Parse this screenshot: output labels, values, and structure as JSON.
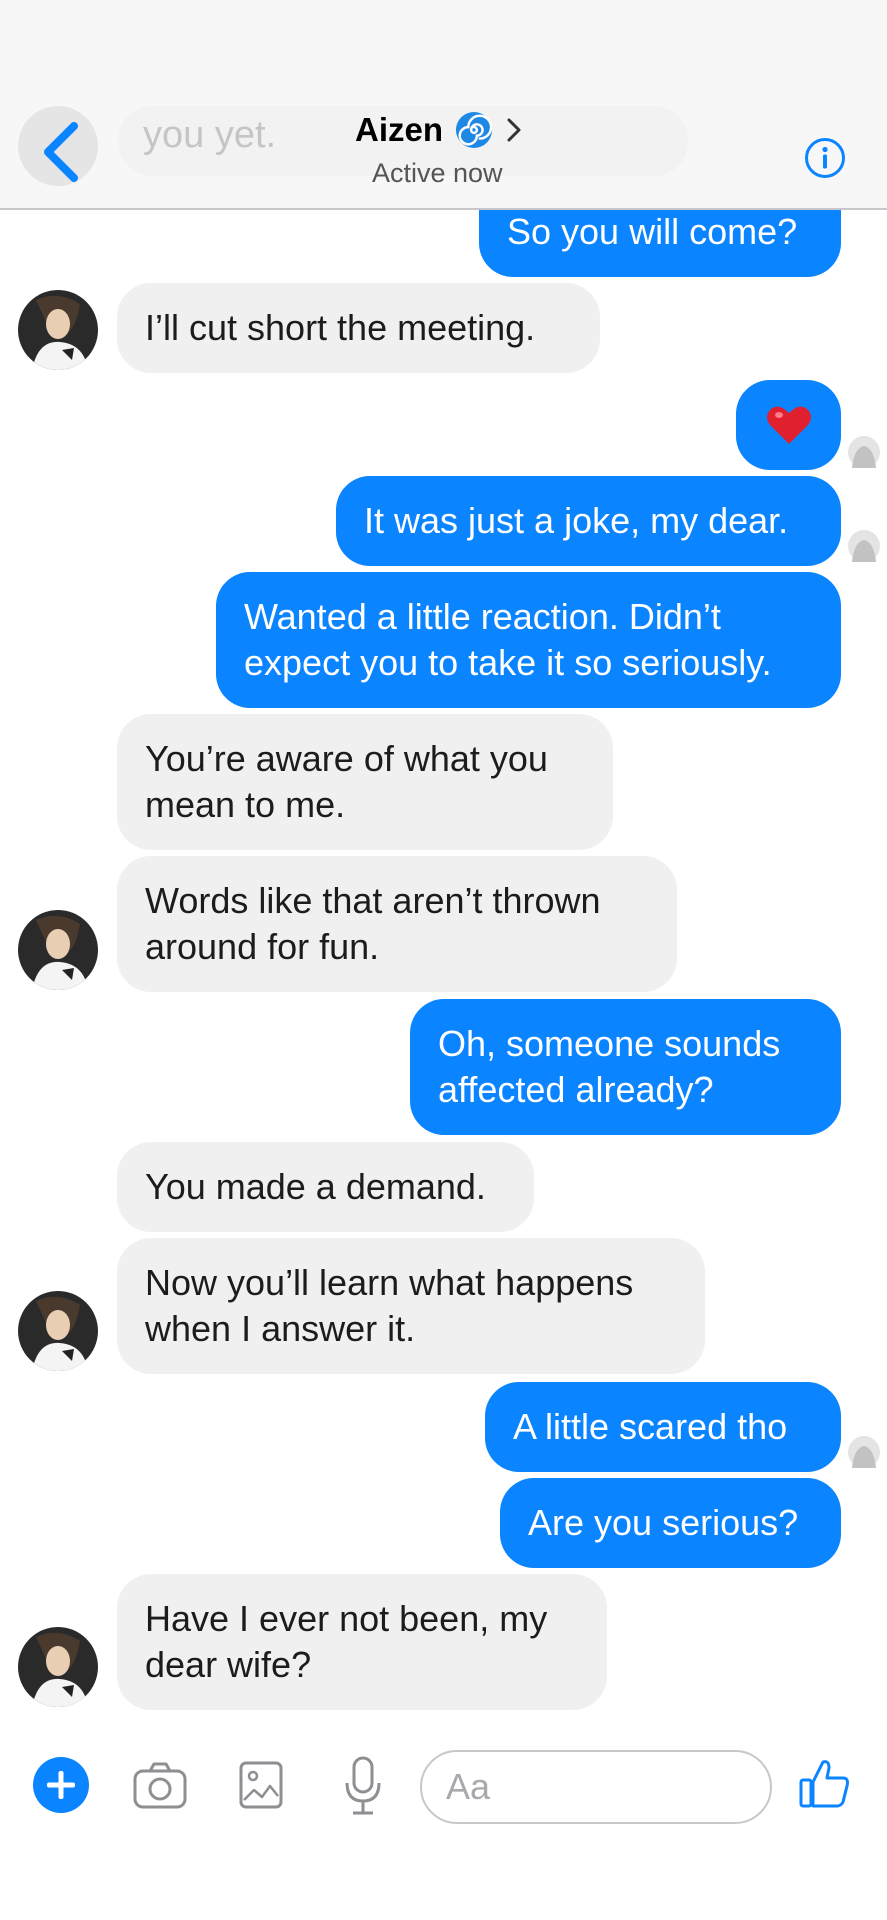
{
  "header": {
    "ghost_text": "you yet.",
    "contact_name": "Aizen",
    "status": "Active now",
    "contact_emoji": "spiral-emoji"
  },
  "messages": [
    {
      "side": "out",
      "text": "So you will come?"
    },
    {
      "side": "in",
      "text": "I’ll cut short the meeting."
    },
    {
      "side": "out",
      "text": "❤️"
    },
    {
      "side": "out",
      "text": "It was just a joke, my dear."
    },
    {
      "side": "out",
      "text": "Wanted a little reaction. Didn’t expect you to take it so seriously."
    },
    {
      "side": "in",
      "text": "You’re aware of what you mean to me."
    },
    {
      "side": "in",
      "text": "Words like that aren’t thrown around for fun."
    },
    {
      "side": "out",
      "text": "Oh, someone sounds affected already?"
    },
    {
      "side": "in",
      "text": "You made a demand."
    },
    {
      "side": "in",
      "text": "Now you’ll learn what happens when I answer it."
    },
    {
      "side": "out",
      "text": "A little scared tho"
    },
    {
      "side": "out",
      "text": "Are you serious?"
    },
    {
      "side": "in",
      "text": "Have I ever not been, my dear wife?"
    }
  ],
  "composer": {
    "placeholder": "Aa",
    "icons": [
      "plus-icon",
      "camera-icon",
      "gallery-icon",
      "microphone-icon",
      "thumbs-up-icon"
    ]
  },
  "colors": {
    "accent": "#0a84ff",
    "incoming_bubble": "#f0f0f0",
    "header_bg": "#f7f7f7"
  }
}
